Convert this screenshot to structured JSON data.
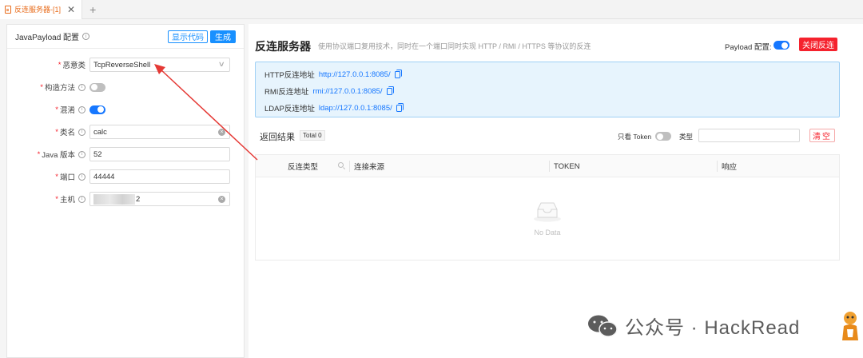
{
  "tabs": [
    {
      "label": "反连服务器-[1]"
    }
  ],
  "config": {
    "title": "JavaPayload 配置",
    "show_code_label": "显示代码",
    "generate_label": "生成",
    "fields": [
      {
        "label": "恶意类",
        "value": "TcpReverseShell"
      },
      {
        "label": "构造方法"
      },
      {
        "label": "混淆"
      },
      {
        "label": "类名",
        "value": "calc"
      },
      {
        "label": "Java 版本",
        "value": "52"
      },
      {
        "label": "端口",
        "value": "44444"
      },
      {
        "label": "主机",
        "value": "2"
      }
    ],
    "toggles": {
      "constructor": false,
      "obfuscate": true
    }
  },
  "server": {
    "title": "反连服务器",
    "description": "使用协议端口复用技术，同时在一个端口同时实现 HTTP / RMI / HTTPS 等协议的反连",
    "payload_config_label": "Payload 配置:",
    "payload_config_on": true,
    "close_label": "关闭反连",
    "addresses": [
      {
        "label": "HTTP反连地址",
        "url": "http://127.0.0.1:8085/"
      },
      {
        "label": "RMI反连地址",
        "url": "rmi://127.0.0.1:8085/"
      },
      {
        "label": "LDAP反连地址",
        "url": "ldap://127.0.0.1:8085/"
      }
    ]
  },
  "results": {
    "label": "返回结果",
    "total": "Total 0",
    "token_only_label": "只看 Token",
    "token_only_on": false,
    "type_label": "类型",
    "type_value": "",
    "clear_label": "清空",
    "columns": [
      "反连类型",
      "连接来源",
      "TOKEN",
      "响应"
    ],
    "empty_text": "No Data"
  },
  "watermark": {
    "text": "公众号 · HackRead"
  },
  "colors": {
    "primary": "#1677ff",
    "danger": "#f5222d",
    "tab_accent": "#e86b1a",
    "annotation_arrow": "#e53935"
  }
}
